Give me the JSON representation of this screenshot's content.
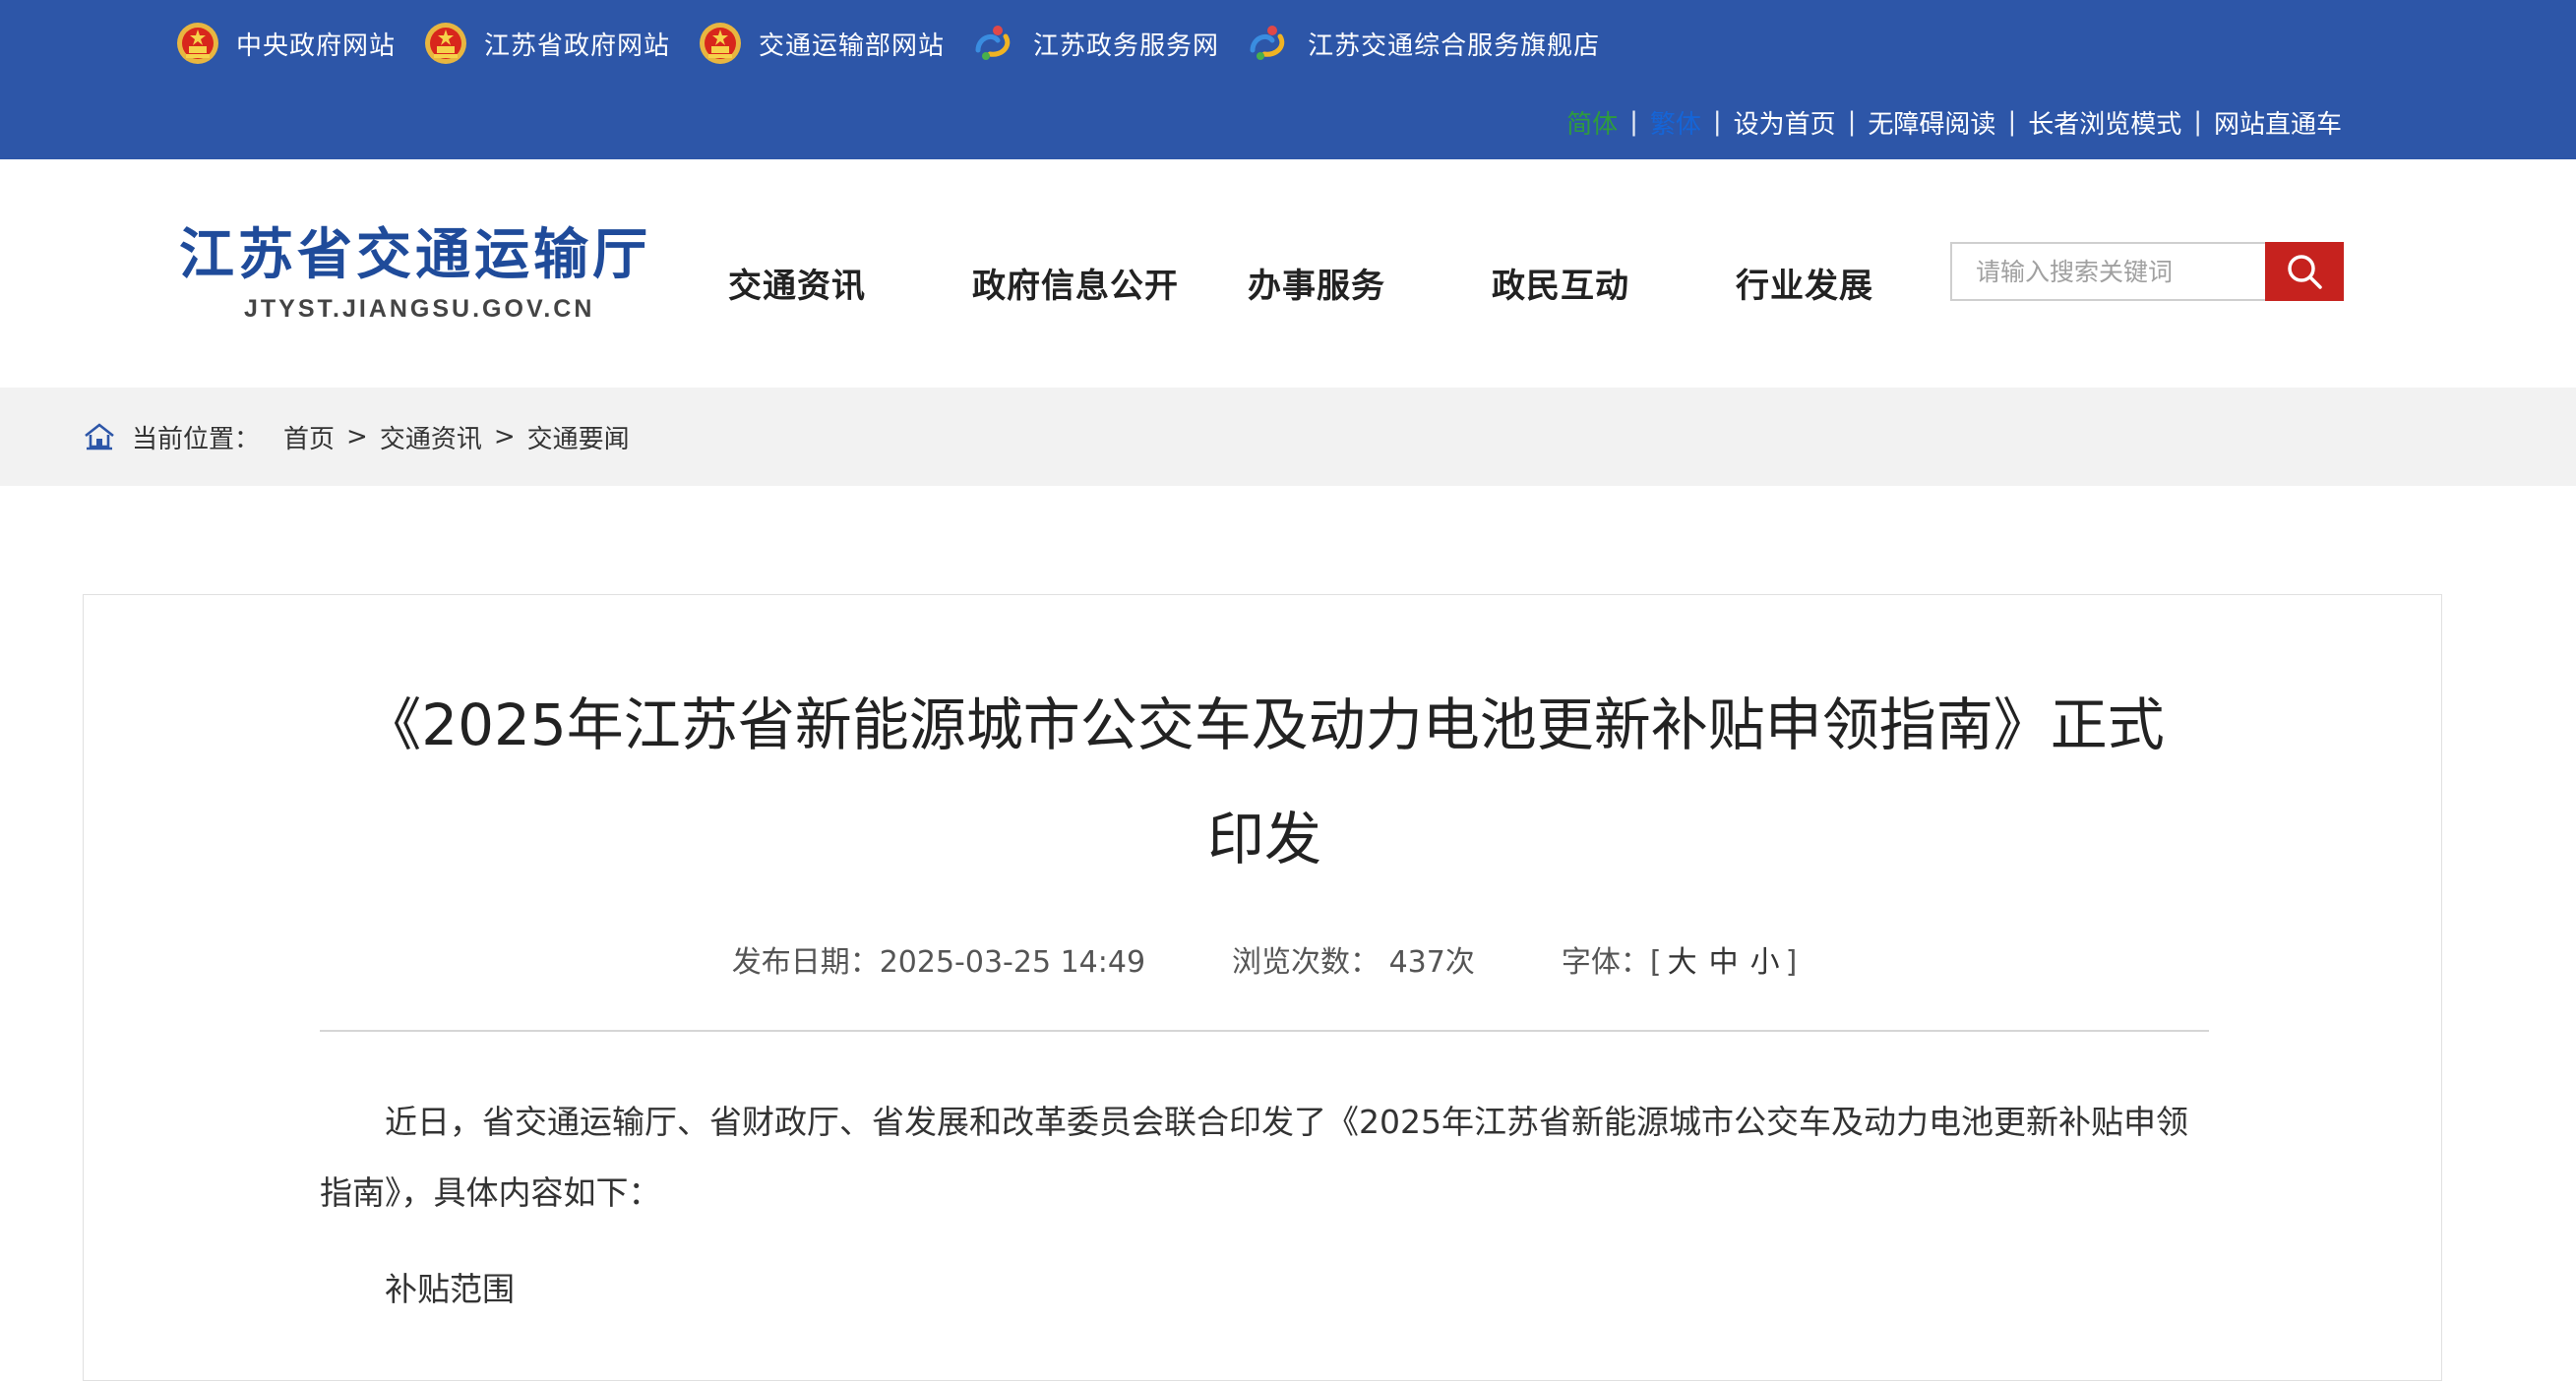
{
  "top_links": [
    {
      "label": "中央政府网站",
      "icon": "national-emblem-icon"
    },
    {
      "label": "江苏省政府网站",
      "icon": "national-emblem-icon"
    },
    {
      "label": "交通运输部网站",
      "icon": "national-emblem-icon"
    },
    {
      "label": "江苏政务服务网",
      "icon": "gov-service-icon"
    },
    {
      "label": "江苏交通综合服务旗舰店",
      "icon": "gov-service-icon"
    }
  ],
  "utility": {
    "simplified": "简体",
    "traditional": "繁体",
    "sep": "|",
    "set_home": "设为首页",
    "accessibility": "无障碍阅读",
    "elder_mode": "长者浏览模式",
    "site_express": "网站直通车"
  },
  "logo": {
    "cn": "江苏省交通运输厅",
    "en": "JTYST.JIANGSU.GOV.CN"
  },
  "nav": [
    "交通资讯",
    "政府信息公开",
    "办事服务",
    "政民互动",
    "行业发展"
  ],
  "search": {
    "placeholder": "请输入搜索关键词"
  },
  "breadcrumb": {
    "label": "当前位置：",
    "items": [
      "首页",
      "交通资讯",
      "交通要闻"
    ],
    "sep": ">"
  },
  "article": {
    "title_line1": "《2025年江苏省新能源城市公交车及动力电池更新补贴申领指南》正式",
    "title_line2": "印发",
    "publish_label": "发布日期：",
    "publish_value": "2025-03-25 14:49",
    "views_label": "浏览次数：",
    "views_value": "437次",
    "font_label": "字体：",
    "font_open": "[",
    "font_large": "大",
    "font_medium": "中",
    "font_small": "小",
    "font_close": "]",
    "para1": "近日，省交通运输厅、省财政厅、省发展和改革委员会联合印发了《2025年江苏省新能源城市公交车及动力电池更新补贴申领指南》，具体内容如下：",
    "section1": "补贴范围"
  },
  "colors": {
    "topbar": "#2d56a8",
    "simplified": "#2e9b3e",
    "traditional": "#1565d8",
    "search_button": "#c6221e",
    "logo": "#1f4b9a"
  }
}
